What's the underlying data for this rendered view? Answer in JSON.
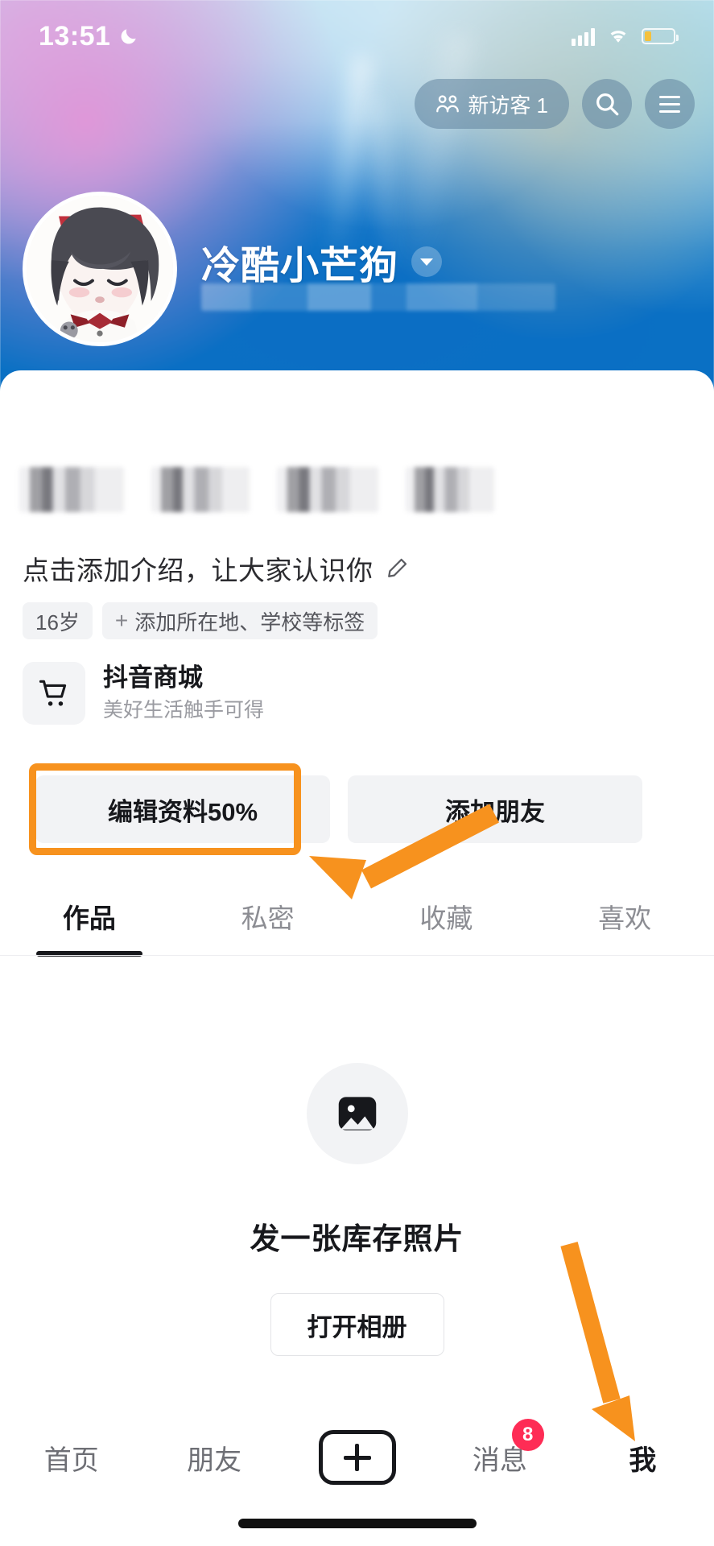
{
  "status_bar": {
    "time": "13:51",
    "dnd_icon": "moon-icon",
    "signal_icon": "signal-bars-icon",
    "wifi_icon": "wifi-icon",
    "battery_icon": "battery-low-icon"
  },
  "header": {
    "visitor_pill": {
      "icon": "people-icon",
      "label": "新访客 1"
    },
    "search_icon": "search-icon",
    "menu_icon": "hamburger-menu-icon"
  },
  "profile": {
    "avatar_alt": "anime-avatar",
    "display_name": "冷酷小芒狗",
    "name_chevron": "chevron-down-icon",
    "id_line_redacted": "",
    "stats_redacted": [
      "",
      "",
      "",
      ""
    ],
    "bio_placeholder": "点击添加介绍，让大家认识你",
    "bio_edit_icon": "pencil-icon",
    "tags": [
      {
        "label": "16岁",
        "has_plus": false
      },
      {
        "label": "添加所在地、学校等标签",
        "has_plus": true,
        "plus": "+"
      }
    ]
  },
  "shop_card": {
    "icon": "shopping-cart-icon",
    "title": "抖音商城",
    "subtitle": "美好生活触手可得"
  },
  "actions": {
    "edit_profile_label": "编辑资料50%",
    "add_friend_label": "添加朋友"
  },
  "tabs": [
    {
      "label": "作品",
      "active": true
    },
    {
      "label": "私密",
      "active": false
    },
    {
      "label": "收藏",
      "active": false
    },
    {
      "label": "喜欢",
      "active": false
    }
  ],
  "empty_state": {
    "icon": "image-placeholder-icon",
    "title": "发一张库存照片",
    "button_label": "打开相册"
  },
  "bottom_nav": [
    {
      "label": "首页",
      "active": false,
      "badge": ""
    },
    {
      "label": "朋友",
      "active": false,
      "badge": ""
    },
    {
      "label": "",
      "icon": "plus-create-icon",
      "active": false,
      "badge": ""
    },
    {
      "label": "消息",
      "active": false,
      "badge": "8"
    },
    {
      "label": "我",
      "active": true,
      "badge": ""
    }
  ],
  "annotations": {
    "highlight_color": "#f7921e",
    "box_target": "编辑资料50%",
    "arrow_1_target": "编辑资料50%",
    "arrow_2_target": "我"
  },
  "colors": {
    "brand_blue": "#0a72c4",
    "badge_red": "#fe2c55",
    "annotation_orange": "#f7921e",
    "text_primary": "#17181c",
    "text_muted": "#8c8d93",
    "chip_bg": "#f2f3f5"
  }
}
